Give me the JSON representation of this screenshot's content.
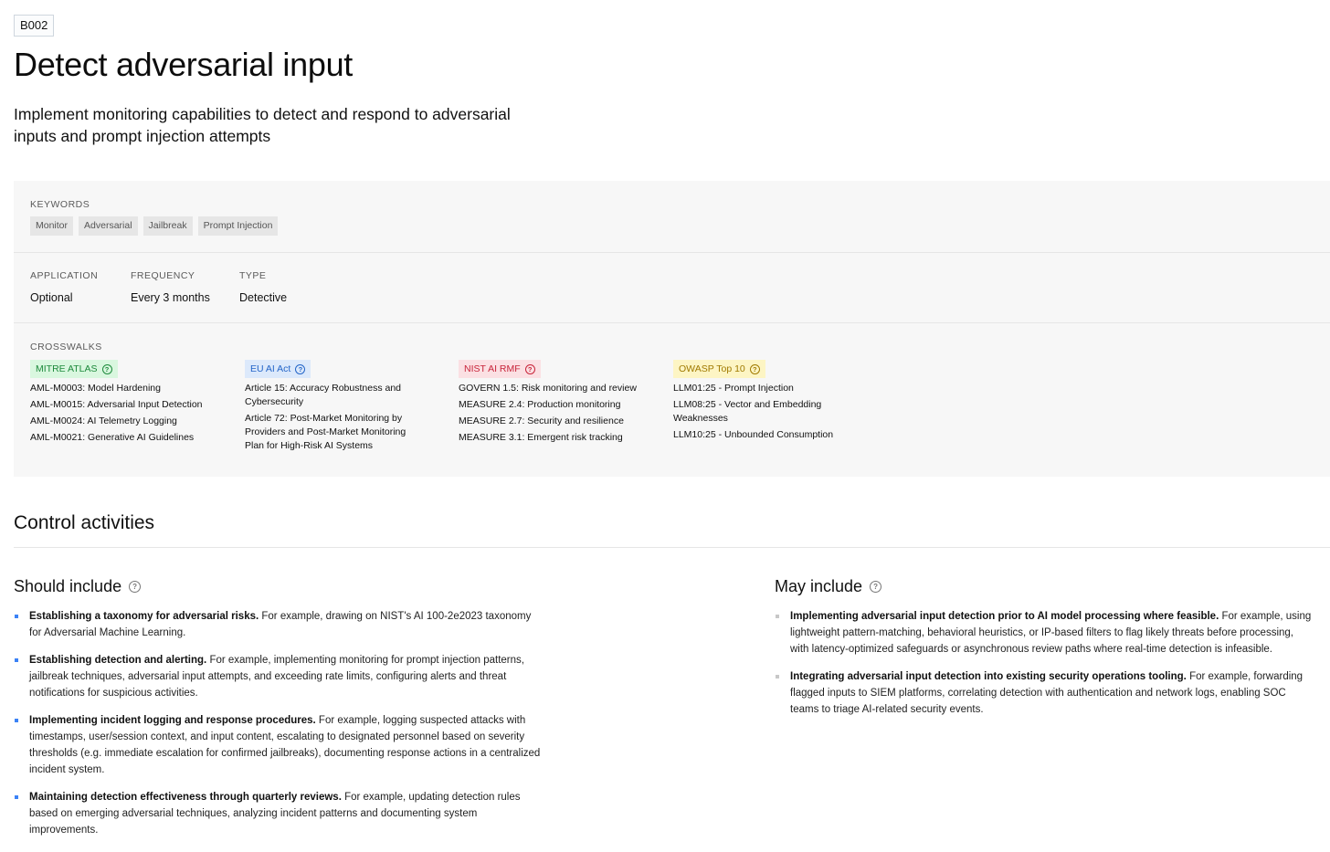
{
  "control": {
    "code": "B002",
    "title": "Detect adversarial input",
    "description": "Implement monitoring capabilities to detect and respond to adversarial inputs and prompt injection attempts"
  },
  "keywords": {
    "label": "KEYWORDS",
    "items": [
      "Monitor",
      "Adversarial",
      "Jailbreak",
      "Prompt Injection"
    ]
  },
  "meta": {
    "application": {
      "label": "APPLICATION",
      "value": "Optional"
    },
    "frequency": {
      "label": "FREQUENCY",
      "value": "Every 3 months"
    },
    "type": {
      "label": "TYPE",
      "value": "Detective"
    }
  },
  "crosswalks": {
    "label": "CROSSWALKS",
    "frameworks": [
      {
        "name": "MITRE ATLAS",
        "bg": "#d9f7df",
        "fg": "#1e8a3c",
        "icon": "help-circle-icon",
        "items": [
          "AML-M0003: Model Hardening",
          "AML-M0015: Adversarial Input Detection",
          "AML-M0024: AI Telemetry Logging",
          "AML-M0021: Generative AI Guidelines"
        ]
      },
      {
        "name": "EU AI Act",
        "bg": "#dce9fb",
        "fg": "#2465c8",
        "icon": "help-circle-icon",
        "items": [
          "Article 15: Accuracy Robustness and Cybersecurity",
          "Article 72: Post-Market Monitoring by Providers and Post-Market Monitoring Plan for High-Risk AI Systems"
        ]
      },
      {
        "name": "NIST AI RMF",
        "bg": "#fbe0e3",
        "fg": "#c8243a",
        "icon": "help-circle-icon",
        "items": [
          "GOVERN 1.5: Risk monitoring and review",
          "MEASURE 2.4: Production monitoring",
          "MEASURE 2.7: Security and resilience",
          "MEASURE 3.1: Emergent risk tracking"
        ]
      },
      {
        "name": "OWASP Top 10",
        "bg": "#fdf5c4",
        "fg": "#a07a00",
        "icon": "help-circle-icon",
        "items": [
          "LLM01:25 - Prompt Injection",
          "LLM08:25 - Vector and Embedding Weaknesses",
          "LLM10:25 - Unbounded Consumption"
        ]
      }
    ]
  },
  "activities": {
    "title": "Control activities",
    "should": {
      "title": "Should include",
      "bullet_color": "#3b82f6",
      "items": [
        {
          "lead": "Establishing a taxonomy for adversarial risks.",
          "text": " For example, drawing on NIST's AI 100-2e2023 taxonomy for Adversarial Machine Learning."
        },
        {
          "lead": "Establishing detection and alerting.",
          "text": " For example, implementing monitoring for prompt injection patterns, jailbreak techniques, adversarial input attempts, and exceeding rate limits, configuring alerts and threat notifications for suspicious activities."
        },
        {
          "lead": "Implementing incident logging and response procedures.",
          "text": " For example, logging suspected attacks with timestamps, user/session context, and input content, escalating to designated personnel based on severity thresholds (e.g. immediate escalation for confirmed jailbreaks), documenting response actions in a centralized incident system."
        },
        {
          "lead": "Maintaining detection effectiveness through quarterly reviews.",
          "text": " For example, updating detection rules based on emerging adversarial techniques, analyzing incident patterns and documenting system improvements."
        }
      ]
    },
    "may": {
      "title": "May include",
      "bullet_color": "#c8c8c8",
      "items": [
        {
          "lead": "Implementing adversarial input detection prior to AI model processing where feasible.",
          "text": " For example, using lightweight pattern-matching, behavioral heuristics, or IP-based filters to flag likely threats before processing, with latency-optimized safeguards or asynchronous review paths where real-time detection is infeasible."
        },
        {
          "lead": "Integrating adversarial input detection into existing security operations tooling.",
          "text": " For example, forwarding flagged inputs to SIEM platforms, correlating detection with authentication and network logs, enabling SOC teams to triage AI-related security events."
        }
      ]
    }
  }
}
